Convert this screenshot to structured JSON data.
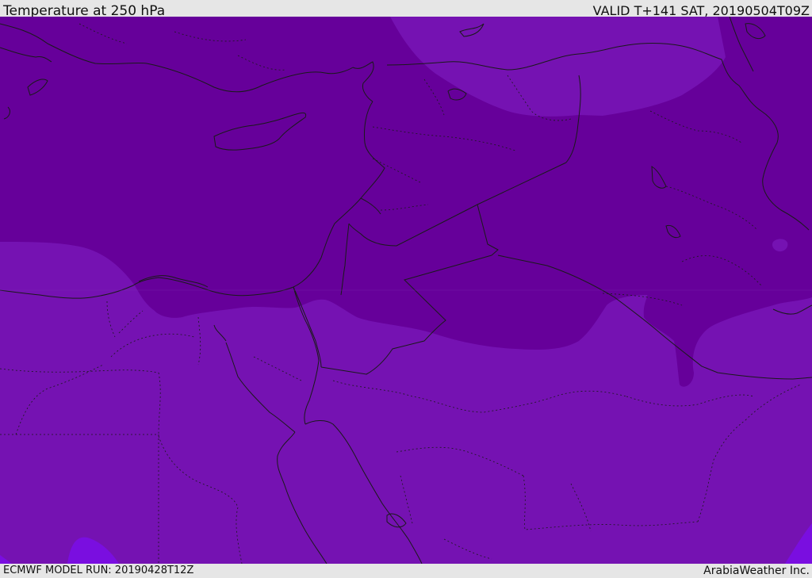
{
  "header": {
    "title": "Temperature at 250 hPa",
    "valid": "VALID T+141 SAT, 20190504T09Z"
  },
  "footer": {
    "model_run": "ECMWF MODEL RUN: 20190428T12Z",
    "credit": "ArabiaWeather Inc."
  },
  "map": {
    "colors": {
      "cold_band": "#66009a",
      "mid_band": "#7512b2",
      "warm_band": "#7a0ee0",
      "coastline": "#1a1a1a",
      "border": "#1a1a1a"
    }
  }
}
